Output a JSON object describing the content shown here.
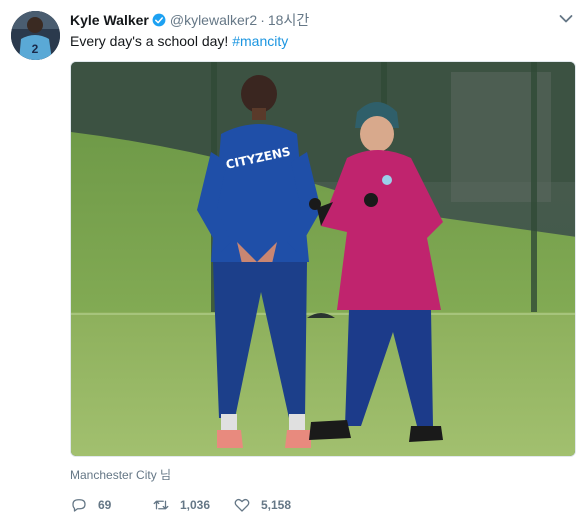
{
  "tweet": {
    "display_name": "Kyle Walker",
    "handle": "@kylewalker2",
    "separator": "·",
    "timestamp": "18시간",
    "text": "Every day's a school day! ",
    "hashtag": "#mancity",
    "tagged": "Manchester City 님",
    "avatar_jersey_number": "2",
    "photo_jacket_text": "CITYZENS"
  },
  "actions": {
    "replies": "69",
    "retweets": "1,036",
    "likes": "5,158"
  },
  "colors": {
    "link": "#1b95e0",
    "secondary_text": "#657786",
    "verified": "#1da1f2"
  },
  "icons": [
    "verified-badge-icon",
    "chevron-down-icon",
    "reply-icon",
    "retweet-icon",
    "like-icon"
  ]
}
